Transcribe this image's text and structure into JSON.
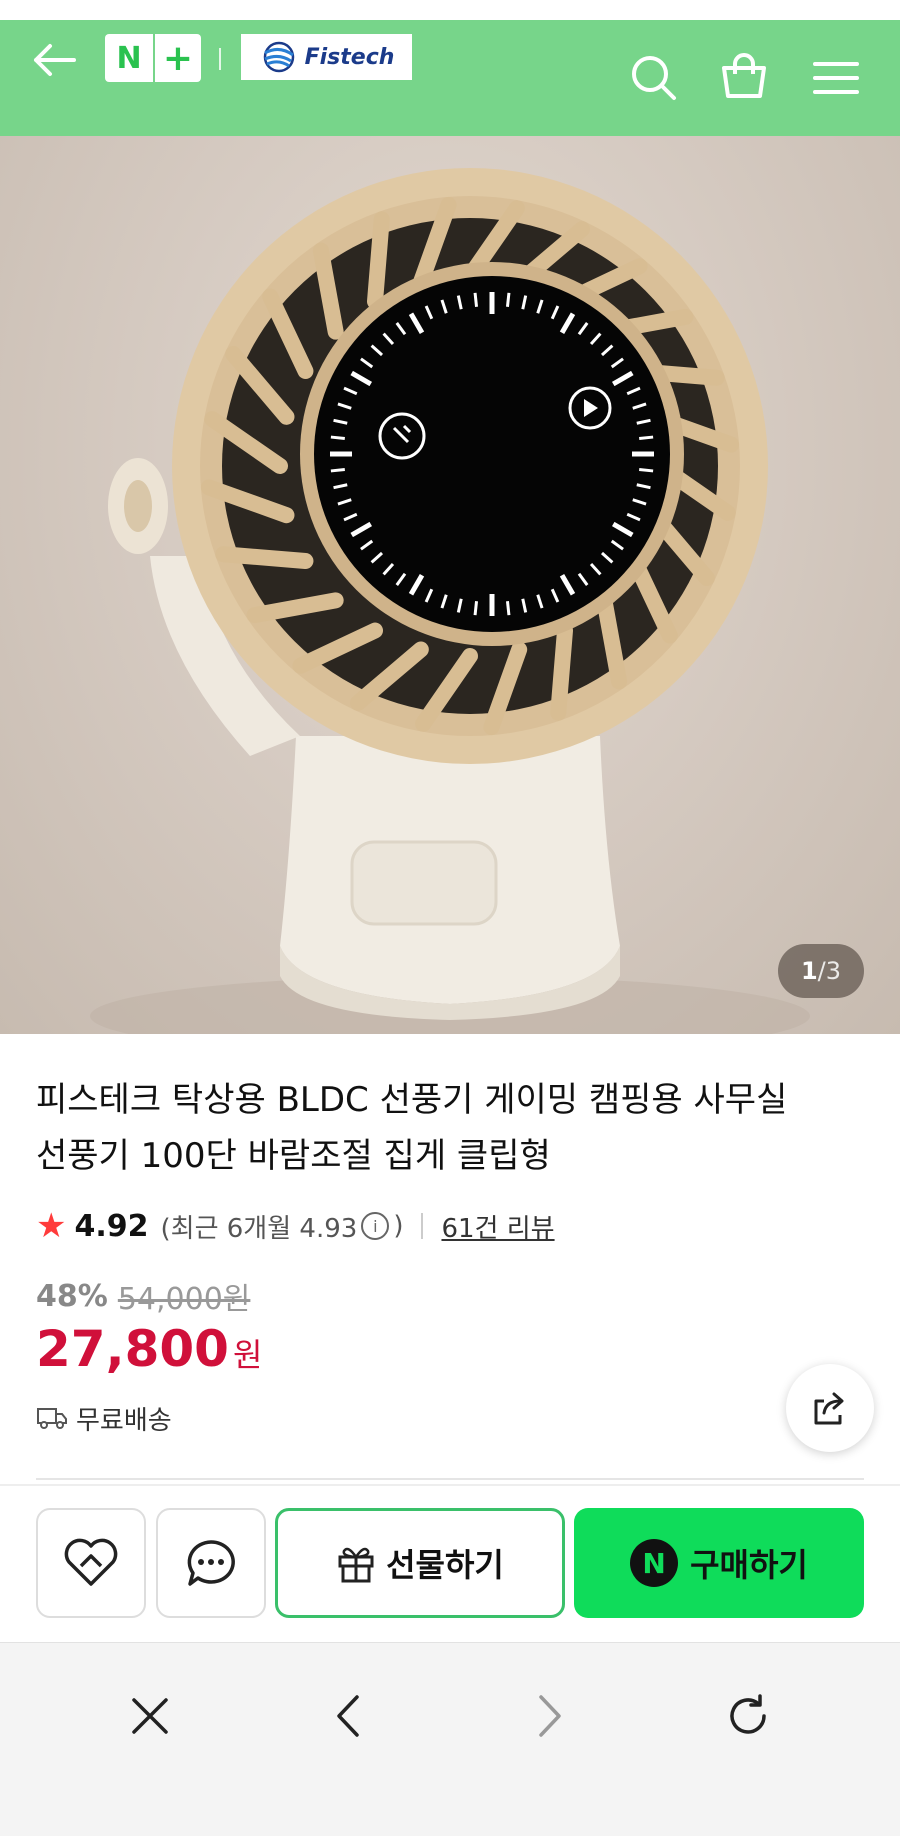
{
  "header": {
    "back_icon": "back-arrow-icon",
    "badge_n": "N",
    "badge_plus": "+",
    "brand": "Fistech",
    "search_icon": "search-icon",
    "bag_icon": "shopping-bag-icon",
    "menu_icon": "hamburger-menu-icon",
    "bg_color": "#77d58a"
  },
  "gallery": {
    "current": "1",
    "separator": "/",
    "total": "3"
  },
  "product": {
    "title_line1": "피스테크 탁상용 BLDC 선풍기 게이밍 캠핑용 사무실",
    "title_line2": "선풍기 100단 바람조절 집게 클립형",
    "rating": "4.92",
    "recent_label": "(최근 6개월 4.93",
    "recent_close": ")",
    "info_glyph": "i",
    "review_count": "61건 리뷰",
    "discount": "48%",
    "original_price": "54,000원",
    "price": "27,800",
    "price_unit": "원",
    "shipping": "무료배송",
    "price_color": "#d0103a"
  },
  "actions": {
    "wish_icon": "heart-tag-icon",
    "chat_icon": "chat-bubble-icon",
    "gift_label": "선물하기",
    "buy_badge": "N",
    "buy_label": "구매하기",
    "buy_color": "#0fdc5a"
  },
  "browser": {
    "close_icon": "close-icon",
    "back_icon": "chevron-left-icon",
    "forward_icon": "chevron-right-icon",
    "reload_icon": "reload-icon"
  }
}
